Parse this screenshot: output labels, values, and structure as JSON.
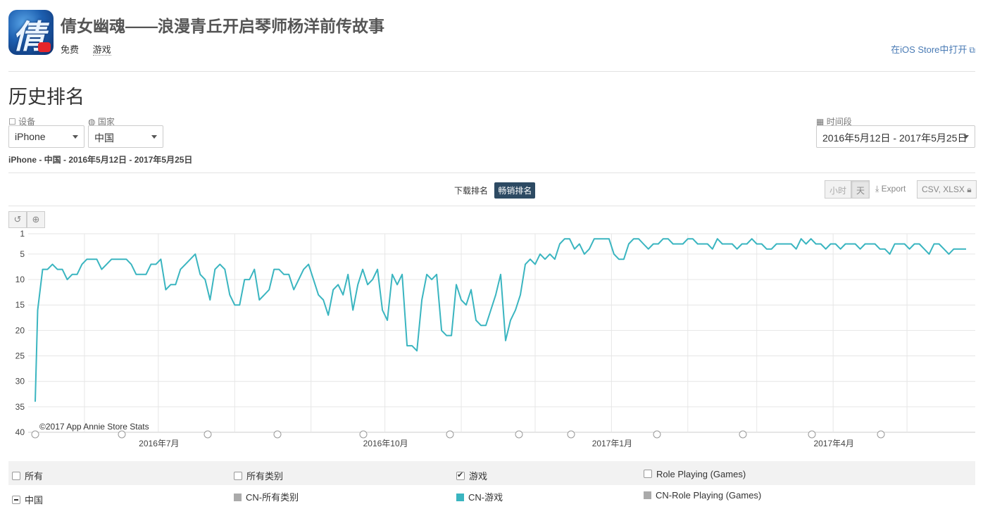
{
  "app": {
    "title": "倩女幽魂——浪漫青丘开启琴师杨洋前传故事",
    "icon_glyph": "倩",
    "price": "免费",
    "genre": "游戏",
    "open_store_label": "在iOS Store中打开",
    "open_store_icon": "external-link-icon"
  },
  "section": {
    "title": "历史排名"
  },
  "filters": {
    "device_label": "设备",
    "device_icon": "device-icon",
    "device_value": "iPhone",
    "country_label": "国家",
    "country_icon": "globe-icon",
    "country_value": "中国",
    "period_label": "时间段",
    "period_icon": "calendar-icon",
    "period_value": "2016年5月12日 - 2017年5月25日"
  },
  "summary": "iPhone - 中国 - 2016年5月12日 - 2017年5月25日",
  "tabs": {
    "download": "下载排名",
    "grossing": "畅销排名"
  },
  "granularity": {
    "hour": "小时",
    "day": "天"
  },
  "export": {
    "label": "Export",
    "formats": "CSV, XLSX",
    "lock_icon": "lock-icon",
    "download_icon": "download-icon"
  },
  "tools": {
    "reset_icon": "reset-icon",
    "zoom_icon": "zoom-icon"
  },
  "chart_data": {
    "type": "line",
    "title": "",
    "xlabel": "",
    "ylabel": "",
    "x_start": "2016-05-12",
    "x_end": "2017-05-25",
    "y_inverted": true,
    "ylim": [
      1,
      40
    ],
    "y_ticks": [
      1,
      5,
      10,
      15,
      20,
      25,
      30,
      35,
      40
    ],
    "x_tick_labels": [
      {
        "date": "2016-07-01",
        "label": "2016年7月"
      },
      {
        "date": "2016-10-01",
        "label": "2016年10月"
      },
      {
        "date": "2017-01-01",
        "label": "2017年1月"
      },
      {
        "date": "2017-04-01",
        "label": "2017年4月"
      }
    ],
    "grid": true,
    "watermark": "©2017 App Annie Store Stats",
    "series": [
      {
        "name": "CN-游戏",
        "color": "#3ab5c0",
        "points": [
          [
            "2016-05-12",
            34
          ],
          [
            "2016-05-13",
            16
          ],
          [
            "2016-05-15",
            8
          ],
          [
            "2016-05-17",
            8
          ],
          [
            "2016-05-19",
            7
          ],
          [
            "2016-05-21",
            8
          ],
          [
            "2016-05-23",
            8
          ],
          [
            "2016-05-25",
            10
          ],
          [
            "2016-05-27",
            9
          ],
          [
            "2016-05-29",
            9
          ],
          [
            "2016-05-31",
            7
          ],
          [
            "2016-06-02",
            6
          ],
          [
            "2016-06-04",
            6
          ],
          [
            "2016-06-06",
            6
          ],
          [
            "2016-06-08",
            8
          ],
          [
            "2016-06-10",
            7
          ],
          [
            "2016-06-12",
            6
          ],
          [
            "2016-06-14",
            6
          ],
          [
            "2016-06-16",
            6
          ],
          [
            "2016-06-18",
            6
          ],
          [
            "2016-06-20",
            7
          ],
          [
            "2016-06-22",
            9
          ],
          [
            "2016-06-24",
            9
          ],
          [
            "2016-06-26",
            9
          ],
          [
            "2016-06-28",
            7
          ],
          [
            "2016-06-30",
            7
          ],
          [
            "2016-07-02",
            6
          ],
          [
            "2016-07-04",
            12
          ],
          [
            "2016-07-06",
            11
          ],
          [
            "2016-07-08",
            11
          ],
          [
            "2016-07-10",
            8
          ],
          [
            "2016-07-12",
            7
          ],
          [
            "2016-07-14",
            6
          ],
          [
            "2016-07-16",
            5
          ],
          [
            "2016-07-18",
            9
          ],
          [
            "2016-07-20",
            10
          ],
          [
            "2016-07-22",
            14
          ],
          [
            "2016-07-24",
            8
          ],
          [
            "2016-07-26",
            7
          ],
          [
            "2016-07-28",
            8
          ],
          [
            "2016-07-30",
            13
          ],
          [
            "2016-08-01",
            15
          ],
          [
            "2016-08-03",
            15
          ],
          [
            "2016-08-05",
            10
          ],
          [
            "2016-08-07",
            10
          ],
          [
            "2016-08-09",
            8
          ],
          [
            "2016-08-11",
            14
          ],
          [
            "2016-08-13",
            13
          ],
          [
            "2016-08-15",
            12
          ],
          [
            "2016-08-17",
            8
          ],
          [
            "2016-08-19",
            8
          ],
          [
            "2016-08-21",
            9
          ],
          [
            "2016-08-23",
            9
          ],
          [
            "2016-08-25",
            12
          ],
          [
            "2016-08-27",
            10
          ],
          [
            "2016-08-29",
            8
          ],
          [
            "2016-08-31",
            7
          ],
          [
            "2016-09-02",
            10
          ],
          [
            "2016-09-04",
            13
          ],
          [
            "2016-09-06",
            14
          ],
          [
            "2016-09-08",
            17
          ],
          [
            "2016-09-10",
            12
          ],
          [
            "2016-09-12",
            11
          ],
          [
            "2016-09-14",
            13
          ],
          [
            "2016-09-16",
            9
          ],
          [
            "2016-09-18",
            16
          ],
          [
            "2016-09-20",
            11
          ],
          [
            "2016-09-22",
            8
          ],
          [
            "2016-09-24",
            11
          ],
          [
            "2016-09-26",
            10
          ],
          [
            "2016-09-28",
            8
          ],
          [
            "2016-09-30",
            16
          ],
          [
            "2016-10-02",
            18
          ],
          [
            "2016-10-04",
            9
          ],
          [
            "2016-10-06",
            11
          ],
          [
            "2016-10-08",
            9
          ],
          [
            "2016-10-10",
            23
          ],
          [
            "2016-10-12",
            23
          ],
          [
            "2016-10-14",
            24
          ],
          [
            "2016-10-16",
            14
          ],
          [
            "2016-10-18",
            9
          ],
          [
            "2016-10-20",
            10
          ],
          [
            "2016-10-22",
            9
          ],
          [
            "2016-10-24",
            20
          ],
          [
            "2016-10-26",
            21
          ],
          [
            "2016-10-28",
            21
          ],
          [
            "2016-10-30",
            11
          ],
          [
            "2016-11-01",
            14
          ],
          [
            "2016-11-03",
            15
          ],
          [
            "2016-11-05",
            12
          ],
          [
            "2016-11-07",
            18
          ],
          [
            "2016-11-09",
            19
          ],
          [
            "2016-11-11",
            19
          ],
          [
            "2016-11-13",
            16
          ],
          [
            "2016-11-15",
            13
          ],
          [
            "2016-11-17",
            9
          ],
          [
            "2016-11-19",
            22
          ],
          [
            "2016-11-21",
            18
          ],
          [
            "2016-11-23",
            16
          ],
          [
            "2016-11-25",
            13
          ],
          [
            "2016-11-27",
            7
          ],
          [
            "2016-11-29",
            6
          ],
          [
            "2016-12-01",
            7
          ],
          [
            "2016-12-03",
            5
          ],
          [
            "2016-12-05",
            6
          ],
          [
            "2016-12-07",
            5
          ],
          [
            "2016-12-09",
            6
          ],
          [
            "2016-12-11",
            3
          ],
          [
            "2016-12-13",
            2
          ],
          [
            "2016-12-15",
            2
          ],
          [
            "2016-12-17",
            4
          ],
          [
            "2016-12-19",
            3
          ],
          [
            "2016-12-21",
            5
          ],
          [
            "2016-12-23",
            4
          ],
          [
            "2016-12-25",
            2
          ],
          [
            "2016-12-27",
            2
          ],
          [
            "2016-12-29",
            2
          ],
          [
            "2016-12-31",
            2
          ],
          [
            "2017-01-02",
            5
          ],
          [
            "2017-01-04",
            6
          ],
          [
            "2017-01-06",
            6
          ],
          [
            "2017-01-08",
            3
          ],
          [
            "2017-01-10",
            2
          ],
          [
            "2017-01-12",
            2
          ],
          [
            "2017-01-14",
            3
          ],
          [
            "2017-01-16",
            4
          ],
          [
            "2017-01-18",
            3
          ],
          [
            "2017-01-20",
            3
          ],
          [
            "2017-01-22",
            2
          ],
          [
            "2017-01-24",
            2
          ],
          [
            "2017-01-26",
            3
          ],
          [
            "2017-01-28",
            3
          ],
          [
            "2017-01-30",
            3
          ],
          [
            "2017-02-01",
            2
          ],
          [
            "2017-02-03",
            2
          ],
          [
            "2017-02-05",
            3
          ],
          [
            "2017-02-07",
            3
          ],
          [
            "2017-02-09",
            3
          ],
          [
            "2017-02-11",
            4
          ],
          [
            "2017-02-13",
            2
          ],
          [
            "2017-02-15",
            3
          ],
          [
            "2017-02-17",
            3
          ],
          [
            "2017-02-19",
            3
          ],
          [
            "2017-02-21",
            4
          ],
          [
            "2017-02-23",
            3
          ],
          [
            "2017-02-25",
            3
          ],
          [
            "2017-02-27",
            2
          ],
          [
            "2017-03-01",
            3
          ],
          [
            "2017-03-03",
            3
          ],
          [
            "2017-03-05",
            4
          ],
          [
            "2017-03-07",
            4
          ],
          [
            "2017-03-09",
            3
          ],
          [
            "2017-03-11",
            3
          ],
          [
            "2017-03-13",
            3
          ],
          [
            "2017-03-15",
            3
          ],
          [
            "2017-03-17",
            4
          ],
          [
            "2017-03-19",
            2
          ],
          [
            "2017-03-21",
            3
          ],
          [
            "2017-03-23",
            2
          ],
          [
            "2017-03-25",
            3
          ],
          [
            "2017-03-27",
            3
          ],
          [
            "2017-03-29",
            4
          ],
          [
            "2017-03-31",
            3
          ],
          [
            "2017-04-02",
            3
          ],
          [
            "2017-04-04",
            4
          ],
          [
            "2017-04-06",
            3
          ],
          [
            "2017-04-08",
            3
          ],
          [
            "2017-04-10",
            3
          ],
          [
            "2017-04-12",
            4
          ],
          [
            "2017-04-14",
            3
          ],
          [
            "2017-04-16",
            3
          ],
          [
            "2017-04-18",
            3
          ],
          [
            "2017-04-20",
            4
          ],
          [
            "2017-04-22",
            4
          ],
          [
            "2017-04-24",
            5
          ],
          [
            "2017-04-26",
            3
          ],
          [
            "2017-04-28",
            3
          ],
          [
            "2017-04-30",
            3
          ],
          [
            "2017-05-02",
            4
          ],
          [
            "2017-05-04",
            3
          ],
          [
            "2017-05-06",
            3
          ],
          [
            "2017-05-08",
            4
          ],
          [
            "2017-05-10",
            5
          ],
          [
            "2017-05-12",
            3
          ],
          [
            "2017-05-14",
            3
          ],
          [
            "2017-05-16",
            4
          ],
          [
            "2017-05-18",
            5
          ],
          [
            "2017-05-20",
            4
          ],
          [
            "2017-05-22",
            4
          ],
          [
            "2017-05-25",
            4
          ]
        ]
      }
    ]
  },
  "legend": {
    "header": [
      {
        "label": "所有",
        "checked": false
      },
      {
        "label": "所有类别",
        "checked": false
      },
      {
        "label": "游戏",
        "checked": true
      },
      {
        "label": "Role Playing (Games)",
        "checked": false
      }
    ],
    "row": {
      "country": "中国",
      "items": [
        {
          "label": "CN-所有类别",
          "color": "#aaaaaa"
        },
        {
          "label": "CN-游戏",
          "color": "#3ab5c0"
        },
        {
          "label": "CN-Role Playing (Games)",
          "color": "#aaaaaa"
        }
      ]
    }
  }
}
